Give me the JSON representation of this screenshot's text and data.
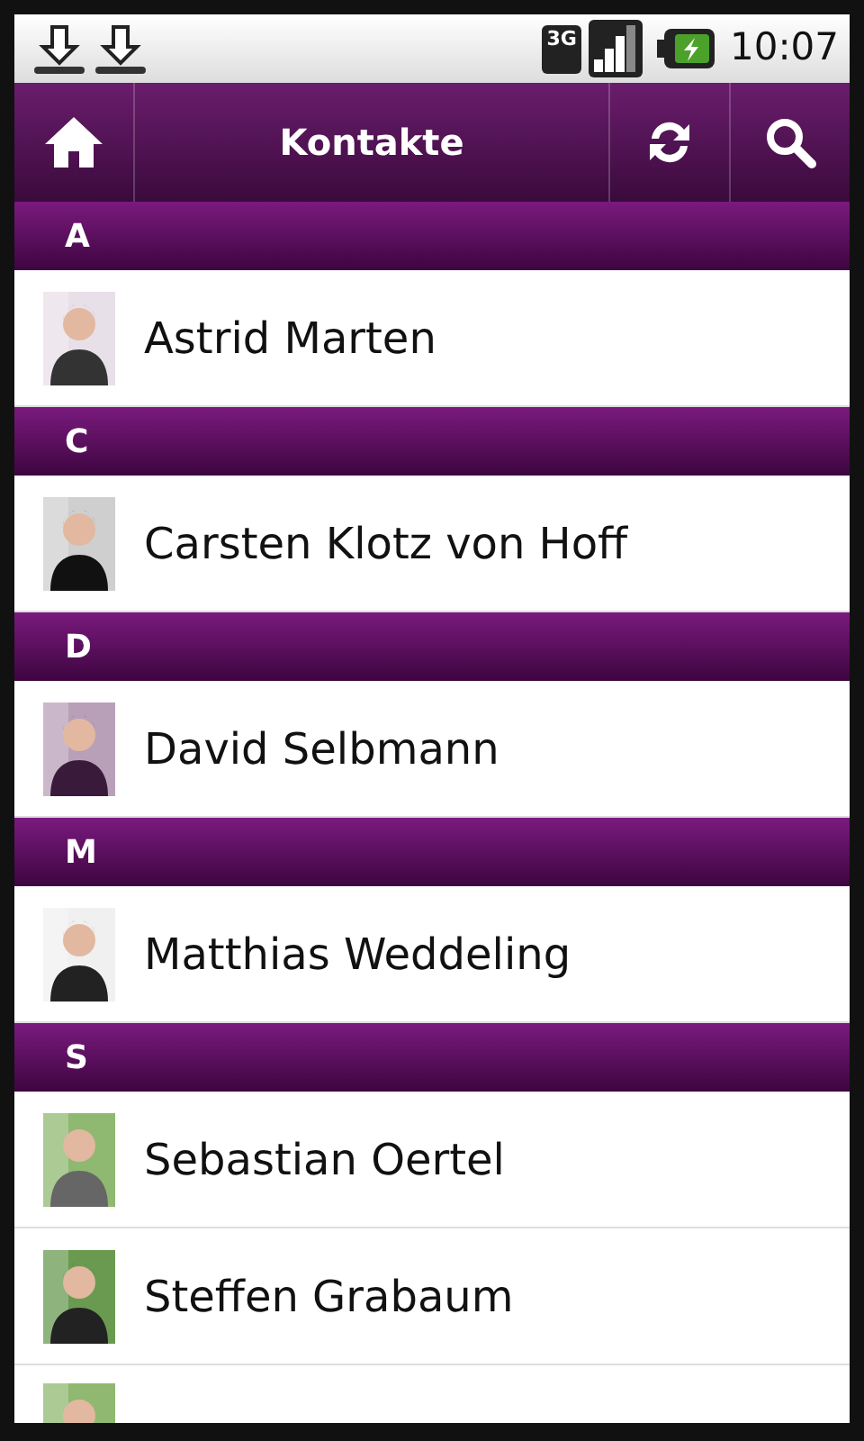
{
  "status_bar": {
    "network": "3G",
    "time": "10:07"
  },
  "header": {
    "title": "Kontakte"
  },
  "sections": [
    {
      "letter": "A",
      "contacts": [
        {
          "kind": "full",
          "name": "Astrid Marten"
        }
      ]
    },
    {
      "letter": "C",
      "contacts": [
        {
          "kind": "full",
          "name": "Carsten Klotz von Hoff"
        }
      ]
    },
    {
      "letter": "D",
      "contacts": [
        {
          "kind": "full",
          "name": "David Selbmann"
        }
      ]
    },
    {
      "letter": "M",
      "contacts": [
        {
          "kind": "full",
          "name": "Matthias Weddeling"
        }
      ]
    },
    {
      "letter": "S",
      "contacts": [
        {
          "kind": "full",
          "name": "Sebastian Oertel"
        },
        {
          "kind": "full",
          "name": "Steffen Grabaum"
        },
        {
          "kind": "cut"
        }
      ]
    }
  ]
}
